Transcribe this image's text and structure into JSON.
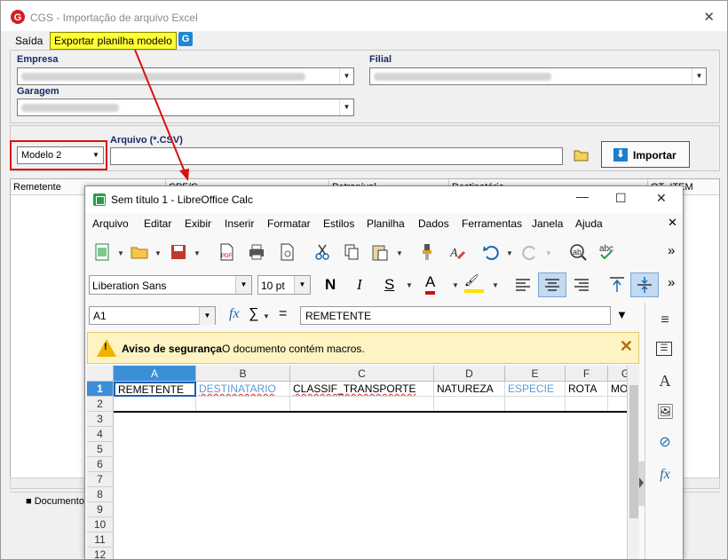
{
  "cgs": {
    "title": "CGS - Importação de arquivo Excel",
    "menu_saida": "Saída",
    "tooltip_exportar": "Exportar planilha modelo",
    "label_empresa": "Empresa",
    "label_filial": "Filial",
    "label_garagem": "Garagem",
    "modelo_value": "Modelo 2",
    "label_arquivo": "Arquivo (*.CSV)",
    "import_button": "Importar",
    "grid_headers": [
      "Remetente",
      "CPF/C...",
      "Petroníval",
      "Destinatário",
      "QT_ITEM"
    ],
    "status_documento": "Documento"
  },
  "lo": {
    "title": "Sem título 1 - LibreOffice Calc",
    "menu": [
      {
        "label": "Arquivo"
      },
      {
        "label": "Editar"
      },
      {
        "label": "Exibir"
      },
      {
        "label": "Inserir"
      },
      {
        "label": "Formatar"
      },
      {
        "label": "Estilos"
      },
      {
        "label": "Planilha"
      },
      {
        "label": "Dados"
      },
      {
        "label": "Ferramentas"
      },
      {
        "label": "Janela"
      },
      {
        "label": "Ajuda"
      }
    ],
    "font_name": "Liberation Sans",
    "font_size": "10 pt",
    "cell_ref": "A1",
    "formula_value": "REMETENTE",
    "security_title": "Aviso de segurança",
    "security_msg": "O documento contém macros.",
    "columns": [
      "A",
      "B",
      "C",
      "D",
      "E",
      "F",
      "G"
    ],
    "rows": [
      "1",
      "2",
      "3",
      "4",
      "5",
      "6",
      "7",
      "8",
      "9",
      "10",
      "11",
      "12"
    ],
    "row1": [
      "REMETENTE",
      "DESTINATARIO",
      "CLASSIF_TRANSPORTE",
      "NATUREZA",
      "ESPECIE",
      "ROTA",
      "MO"
    ]
  }
}
